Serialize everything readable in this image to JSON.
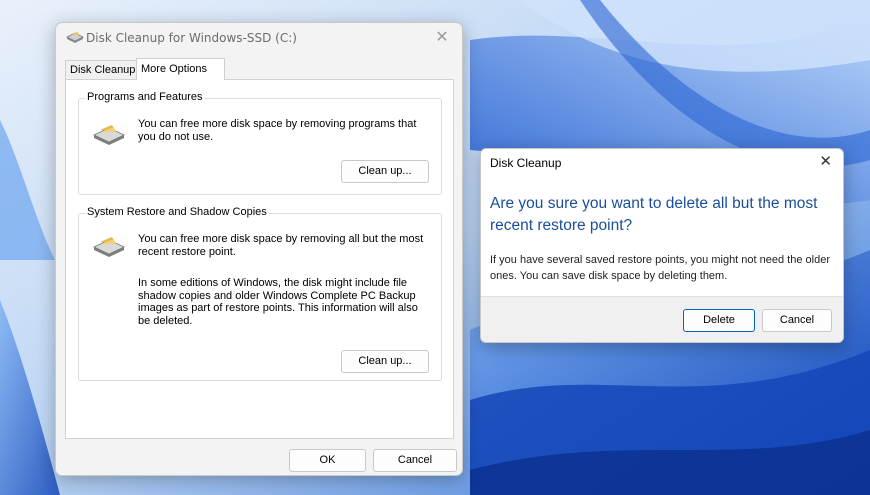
{
  "main_window": {
    "title": "Disk Cleanup for Windows-SSD (C:)",
    "tabs": [
      "Disk Cleanup",
      "More Options"
    ],
    "programs_group": {
      "label": "Programs and Features",
      "description": "You can free more disk space by removing programs that you do not use.",
      "button": "Clean up..."
    },
    "restore_group": {
      "label": "System Restore and Shadow Copies",
      "description": "You can free more disk space by removing all but the most recent restore point.",
      "description2": "In some editions of Windows, the disk might include file shadow copies and older Windows Complete PC Backup images as part of restore points. This information will also be deleted.",
      "button": "Clean up..."
    },
    "ok_label": "OK",
    "cancel_label": "Cancel"
  },
  "dialog": {
    "title": "Disk Cleanup",
    "heading": "Are you sure you want to delete all but the most recent restore point?",
    "body": "If you have several saved restore points, you might not need the older ones. You can save disk space by deleting them.",
    "delete_label": "Delete",
    "cancel_label": "Cancel"
  },
  "colors": {
    "accent": "#0067c0",
    "heading": "#1a4e9a",
    "wallpaper": "#1e63d6"
  }
}
